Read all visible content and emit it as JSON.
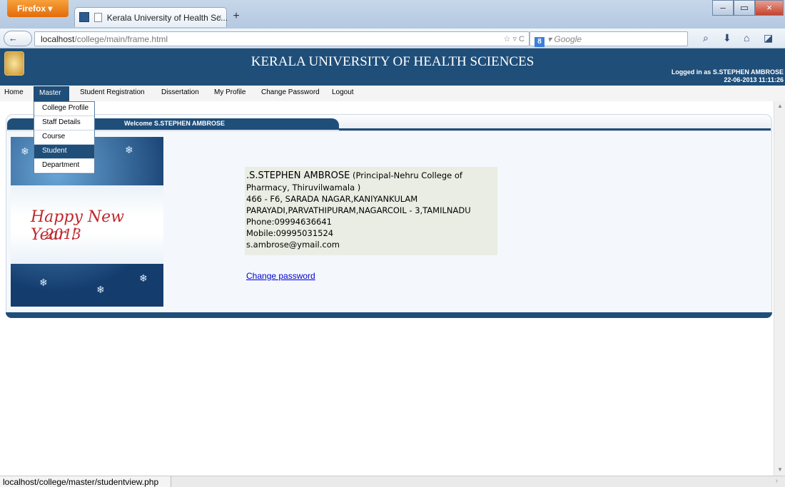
{
  "browser": {
    "firefox_label": "Firefox",
    "firefox_caret": "▾",
    "tab_title": "Kerala University of Health Sc...",
    "tab_close": "×",
    "new_tab": "+",
    "url_host": "localhost",
    "url_path": "/college/main/frame.html",
    "url_icons": "☆ ▿ C",
    "search_engine_icon": "8",
    "search_placeholder": "Google",
    "search_caret": "▾",
    "search_icon": "⌕",
    "download_icon": "⬇",
    "home_icon": "⌂",
    "menu_icon": "◪",
    "back_forward": "← ",
    "win_min": "–",
    "win_max": "▭",
    "win_close": "×",
    "status_url": "localhost/college/master/studentview.php"
  },
  "header": {
    "title": "KERALA UNIVERSITY OF HEALTH SCIENCES",
    "logged_in": "Logged in as S.STEPHEN AMBROSE",
    "datetime": "22-06-2013 11:11:26"
  },
  "menu": {
    "items": [
      "Home",
      "Master",
      "Student Registration",
      "Dissertation",
      "My Profile",
      "Change Password",
      "Logout"
    ],
    "master_dropdown": [
      "College Profile",
      "Staff Details",
      "Course",
      "Student",
      "Department"
    ]
  },
  "panel": {
    "welcome": "Welcome S.STEPHEN AMBROSE",
    "greeting_line1": "Happy New Year !",
    "greeting_line2": "2013",
    "name": ".S.STEPHEN AMBROSE",
    "role": "(Principal-Nehru College of Pharmacy, Thiruvilwamala )",
    "address1": "466 - F6, SARADA NAGAR,KANIYANKULAM",
    "address2": "PARAYADI,PARVATHIPURAM,NAGARCOIL - 3,TAMILNADU",
    "phone": "Phone:09994636641",
    "mobile": "Mobile:09995031524",
    "email": "s.ambrose@ymail.com",
    "change_password_link": "Change password"
  },
  "colors": {
    "header_bg": "#1f4e79",
    "menu_bg": "#f4f4f4",
    "info_box_bg": "#e9ede4",
    "link": "#0000cc",
    "greeting": "#c0282d"
  },
  "icons": {
    "scroll_up": "▲",
    "scroll_down": "▼",
    "status_arrow": "›"
  }
}
